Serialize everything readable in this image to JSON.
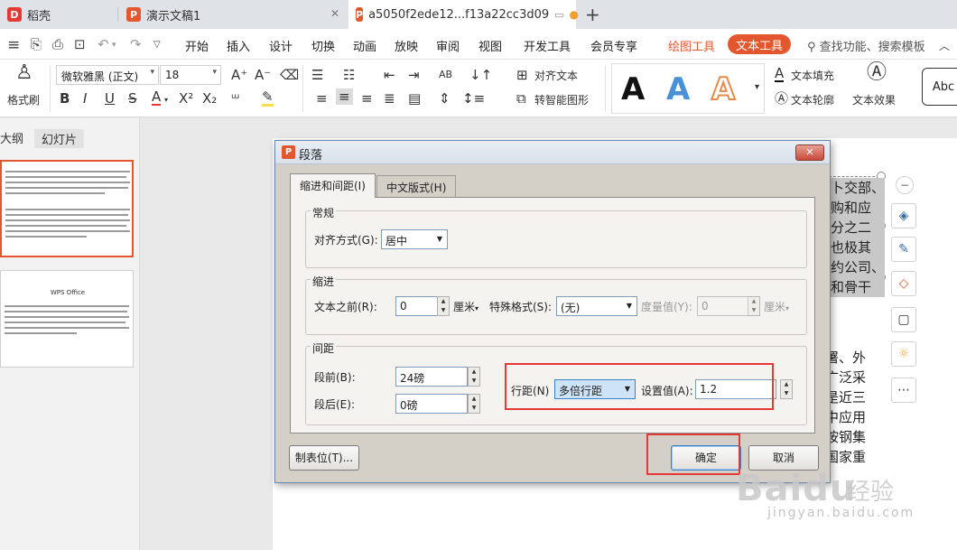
{
  "tabs": [
    {
      "label": "稻壳",
      "logo": "D",
      "color": "#e53935"
    },
    {
      "label": "演示文稿1",
      "logo": "P",
      "color": "#e4572e"
    },
    {
      "label": "a5050f2ede12...f13a22cc3d09",
      "logo": "P",
      "color": "#e4572e"
    }
  ],
  "menu": [
    "开始",
    "插入",
    "设计",
    "切换",
    "动画",
    "放映",
    "审阅",
    "视图",
    "开发工具",
    "会员专享"
  ],
  "menu_drawing_tools": "绘图工具",
  "menu_text_tools": "文本工具",
  "menu_search": "查找功能、搜索模板",
  "ribbon": {
    "format_painter": "格式刷",
    "font_name": "微软雅黑 (正文)",
    "font_size": "18",
    "align_text": "对齐文本",
    "smart_shape": "转智能图形",
    "text_fill": "文本填充",
    "text_outline": "文本轮廓",
    "text_effect": "文本效果",
    "style_sample": "Abc",
    "wordart_letter": "A"
  },
  "left_panel": {
    "tab_outline": "大纲",
    "tab_slides": "幻灯片",
    "thumb2_title": "WPS Office"
  },
  "canvas_text": {
    "col1": [
      "卜交部、",
      "购和应",
      "分之二",
      "也极其",
      "约公司、",
      "和骨干"
    ],
    "col2": [
      "署、外",
      "广泛采",
      "是近三",
      "中应用",
      "按钢集",
      "国家重"
    ]
  },
  "dialog": {
    "title": "段落",
    "tab_indent": "缩进和间距(I)",
    "tab_chinese": "中文版式(H)",
    "general_label": "常规",
    "align_label": "对齐方式(G):",
    "align_value": "居中",
    "indent_label": "缩进",
    "before_text_label": "文本之前(R):",
    "before_text_value": "0",
    "before_text_unit": "厘米",
    "special_label": "特殊格式(S):",
    "special_value": "(无)",
    "measure_label": "度量值(Y):",
    "measure_value": "0",
    "measure_unit": "厘米",
    "spacing_label": "间距",
    "before_label": "段前(B):",
    "before_value": "24磅",
    "after_label": "段后(E):",
    "after_value": "0磅",
    "line_spacing_label": "行距(N)",
    "line_spacing_value": "多倍行距",
    "set_value_label": "设置值(A):",
    "set_value": "1.2",
    "tabs_button": "制表位(T)...",
    "ok_button": "确定",
    "cancel_button": "取消"
  },
  "watermark": {
    "brand": "Baidu",
    "brand_cn": "经验",
    "site": "jingyan.baidu.com"
  }
}
